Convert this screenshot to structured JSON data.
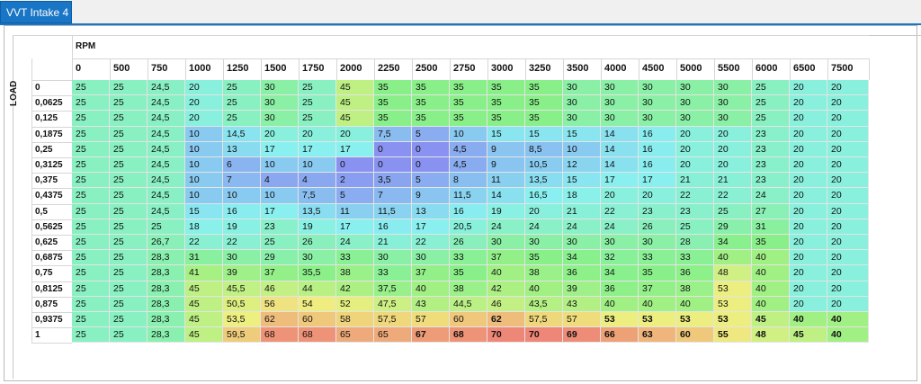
{
  "tab": {
    "title": "VVT Intake 4"
  },
  "table": {
    "x_axis_label": "RPM",
    "y_axis_label": "LOAD",
    "rpm": [
      "0",
      "500",
      "750",
      "1000",
      "1250",
      "1500",
      "1750",
      "2000",
      "2250",
      "2500",
      "2750",
      "3000",
      "3250",
      "3500",
      "4000",
      "4500",
      "5000",
      "5500",
      "6000",
      "6500",
      "7500"
    ],
    "load": [
      "0",
      "0,0625",
      "0,125",
      "0,1875",
      "0,25",
      "0,3125",
      "0,375",
      "0,4375",
      "0,5",
      "0,5625",
      "0,625",
      "0,6875",
      "0,75",
      "0,8125",
      "0,875",
      "0,9375",
      "1"
    ],
    "rows": [
      [
        "25",
        "25",
        "24,5",
        "20",
        "25",
        "30",
        "25",
        "45",
        "35",
        "35",
        "35",
        "35",
        "35",
        "30",
        "30",
        "30",
        "30",
        "30",
        "25",
        "20",
        "20"
      ],
      [
        "25",
        "25",
        "24,5",
        "20",
        "25",
        "30",
        "25",
        "45",
        "35",
        "35",
        "35",
        "35",
        "35",
        "30",
        "30",
        "30",
        "30",
        "30",
        "25",
        "20",
        "20"
      ],
      [
        "25",
        "25",
        "24,5",
        "20",
        "25",
        "30",
        "25",
        "45",
        "35",
        "35",
        "35",
        "35",
        "35",
        "30",
        "30",
        "30",
        "30",
        "30",
        "25",
        "20",
        "20"
      ],
      [
        "25",
        "25",
        "24,5",
        "10",
        "14,5",
        "20",
        "20",
        "20",
        "7,5",
        "5",
        "10",
        "15",
        "15",
        "15",
        "14",
        "16",
        "20",
        "20",
        "23",
        "20",
        "20"
      ],
      [
        "25",
        "25",
        "24,5",
        "10",
        "13",
        "17",
        "17",
        "17",
        "0",
        "0",
        "4,5",
        "9",
        "8,5",
        "10",
        "14",
        "16",
        "20",
        "20",
        "23",
        "20",
        "20"
      ],
      [
        "25",
        "25",
        "24,5",
        "10",
        "6",
        "10",
        "10",
        "0",
        "0",
        "0",
        "4,5",
        "9",
        "10,5",
        "12",
        "14",
        "16",
        "20",
        "20",
        "23",
        "20",
        "20"
      ],
      [
        "25",
        "25",
        "24,5",
        "10",
        "7",
        "4",
        "4",
        "2",
        "3,5",
        "5",
        "8",
        "11",
        "13,5",
        "15",
        "17",
        "17",
        "21",
        "21",
        "23",
        "20",
        "20"
      ],
      [
        "25",
        "25",
        "24,5",
        "10",
        "10",
        "10",
        "7,5",
        "5",
        "7",
        "9",
        "11,5",
        "14",
        "16,5",
        "18",
        "20",
        "20",
        "22",
        "22",
        "24",
        "20",
        "20"
      ],
      [
        "25",
        "25",
        "24,5",
        "15",
        "16",
        "17",
        "13,5",
        "11",
        "11,5",
        "13",
        "16",
        "19",
        "20",
        "21",
        "22",
        "23",
        "23",
        "25",
        "27",
        "20",
        "20"
      ],
      [
        "25",
        "25",
        "25",
        "18",
        "19",
        "23",
        "19",
        "17",
        "16",
        "17",
        "20,5",
        "24",
        "24",
        "24",
        "24",
        "26",
        "25",
        "29",
        "31",
        "20",
        "20"
      ],
      [
        "25",
        "25",
        "26,7",
        "22",
        "22",
        "25",
        "26",
        "24",
        "21",
        "22",
        "26",
        "30",
        "30",
        "30",
        "30",
        "30",
        "28",
        "34",
        "35",
        "20",
        "20"
      ],
      [
        "25",
        "25",
        "28,3",
        "31",
        "30",
        "29",
        "30",
        "33",
        "30",
        "30",
        "33",
        "37",
        "35",
        "34",
        "32",
        "33",
        "33",
        "40",
        "40",
        "20",
        "20"
      ],
      [
        "25",
        "25",
        "28,3",
        "41",
        "39",
        "37",
        "35,5",
        "38",
        "33",
        "37",
        "35",
        "40",
        "38",
        "36",
        "34",
        "35",
        "36",
        "48",
        "40",
        "20",
        "20"
      ],
      [
        "25",
        "25",
        "28,3",
        "45",
        "45,5",
        "46",
        "44",
        "42",
        "37,5",
        "40",
        "38",
        "42",
        "40",
        "39",
        "36",
        "37",
        "38",
        "53",
        "40",
        "20",
        "20"
      ],
      [
        "25",
        "25",
        "28,3",
        "45",
        "50,5",
        "56",
        "54",
        "52",
        "47,5",
        "43",
        "44,5",
        "46",
        "43,5",
        "43",
        "40",
        "40",
        "40",
        "53",
        "40",
        "20",
        "20"
      ],
      [
        "25",
        "25",
        "28,3",
        "45",
        "53,5",
        "62",
        "60",
        "58",
        "57,5",
        "57",
        "60",
        "62",
        "57,5",
        "57",
        "53",
        "53",
        "53",
        "53",
        "45",
        "40",
        "40"
      ],
      [
        "25",
        "25",
        "28,3",
        "45",
        "59,5",
        "68",
        "68",
        "65",
        "65",
        "67",
        "68",
        "70",
        "70",
        "69",
        "66",
        "63",
        "60",
        "55",
        "48",
        "45",
        "40"
      ]
    ],
    "bold_cells": [
      [
        15,
        11
      ],
      [
        15,
        14
      ],
      [
        15,
        15
      ],
      [
        15,
        16
      ],
      [
        15,
        17
      ],
      [
        15,
        18
      ],
      [
        15,
        19
      ],
      [
        15,
        20
      ],
      [
        16,
        9
      ],
      [
        16,
        10
      ],
      [
        16,
        11
      ],
      [
        16,
        12
      ],
      [
        16,
        13
      ],
      [
        16,
        14
      ],
      [
        16,
        15
      ],
      [
        16,
        16
      ],
      [
        16,
        17
      ],
      [
        16,
        18
      ],
      [
        16,
        19
      ],
      [
        16,
        20
      ]
    ]
  }
}
